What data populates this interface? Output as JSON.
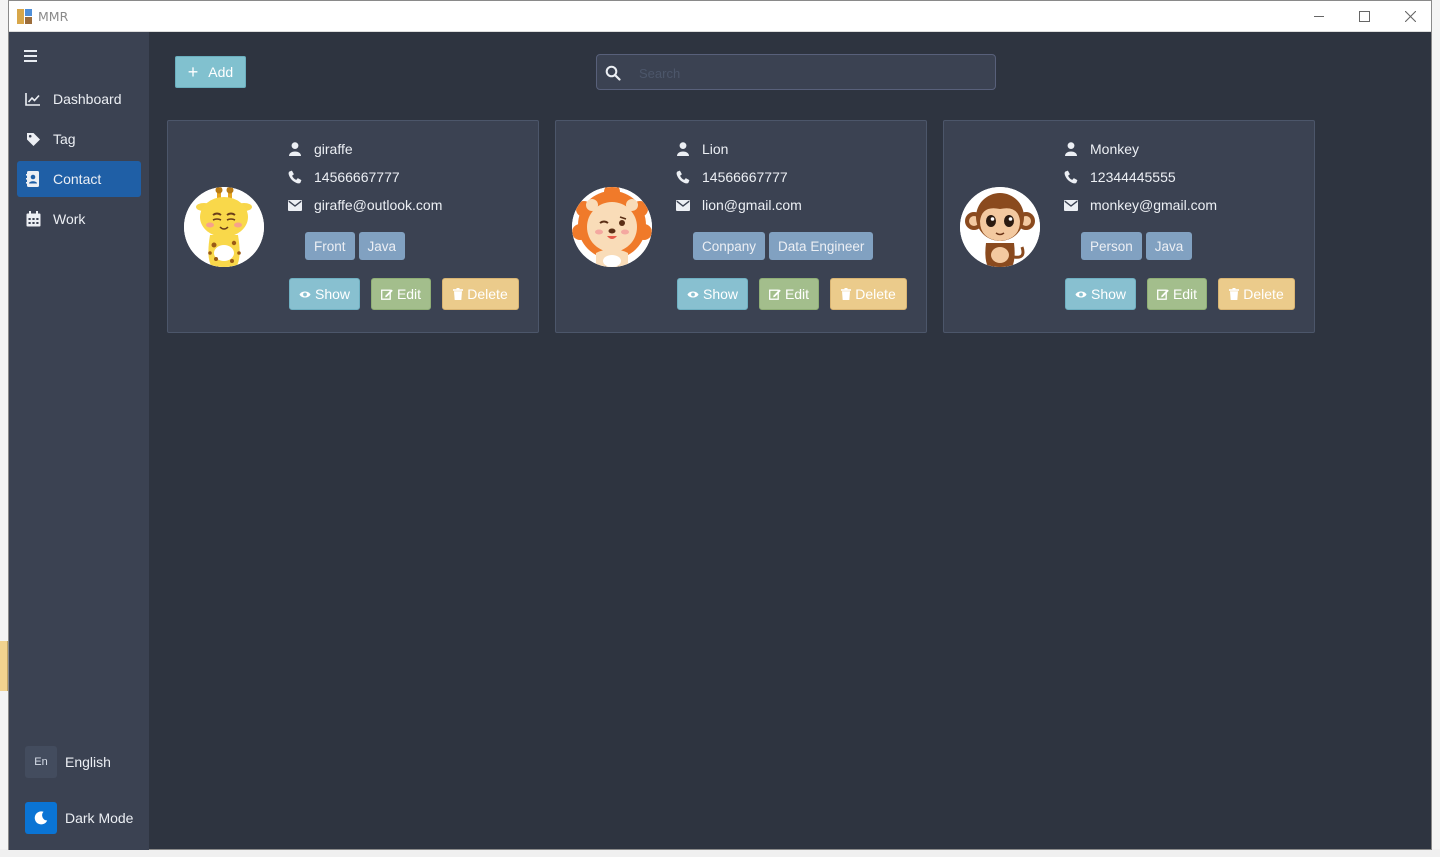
{
  "window": {
    "title": "MMR"
  },
  "sidebar": {
    "items": [
      {
        "label": "Dashboard",
        "icon": "chart-line-icon",
        "active": false
      },
      {
        "label": "Tag",
        "icon": "tag-icon",
        "active": false
      },
      {
        "label": "Contact",
        "icon": "address-book-icon",
        "active": true
      },
      {
        "label": "Work",
        "icon": "calendar-icon",
        "active": false
      }
    ],
    "language": {
      "badge": "En",
      "label": "English"
    },
    "theme": {
      "label": "Dark Mode",
      "icon": "moon-icon"
    }
  },
  "toolbar": {
    "add_label": "Add"
  },
  "search": {
    "placeholder": "Search",
    "value": ""
  },
  "actions": {
    "show": "Show",
    "edit": "Edit",
    "delete": "Delete"
  },
  "contacts": [
    {
      "name": "giraffe",
      "phone": "14566667777",
      "email": "giraffe@outlook.com",
      "tags": [
        "Front",
        "Java"
      ],
      "avatar": "giraffe"
    },
    {
      "name": "Lion",
      "phone": "14566667777",
      "email": "lion@gmail.com",
      "tags": [
        "Conpany",
        "Data Engineer"
      ],
      "avatar": "lion"
    },
    {
      "name": "Monkey",
      "phone": "12344445555",
      "email": "monkey@gmail.com",
      "tags": [
        "Person",
        "Java"
      ],
      "avatar": "monkey"
    }
  ],
  "colors": {
    "background": "#2e3440",
    "sidebar": "#3b4252",
    "active": "#1f5fa6",
    "tag": "#81a1c1",
    "show": "#88c0d0",
    "edit": "#a3be8c",
    "delete": "#ebcb8b",
    "dark_mode_toggle": "#0a74d4"
  }
}
